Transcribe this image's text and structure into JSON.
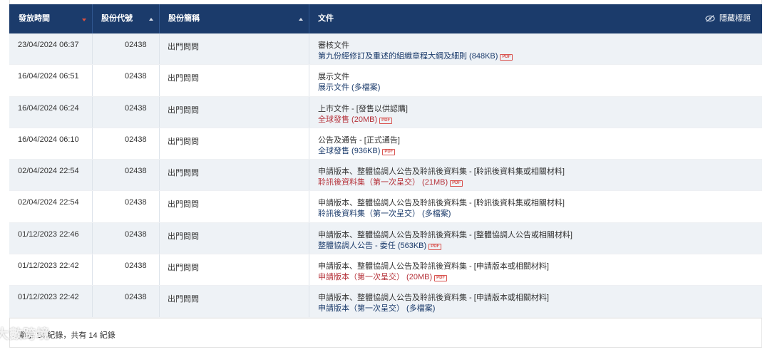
{
  "header": {
    "col_date": "發放時間",
    "col_code": "股份代號",
    "col_name": "股份簡稱",
    "col_doc": "文件",
    "hide_label": "隱藏標題"
  },
  "rows": [
    {
      "date": "23/04/2024 06:37",
      "code": "02438",
      "name": "出門問問",
      "doc_title": "審核文件",
      "doc_link": "第九份經修訂及重述的組織章程大綱及細則 (848KB)",
      "pdf": "PDF",
      "link_color": "normal"
    },
    {
      "date": "16/04/2024 06:51",
      "code": "02438",
      "name": "出門問問",
      "doc_title": "展示文件",
      "doc_link": "展示文件 (多檔案)",
      "pdf": "",
      "link_color": "normal"
    },
    {
      "date": "16/04/2024 06:24",
      "code": "02438",
      "name": "出門問問",
      "doc_title": "上市文件 - [發售以供認購]",
      "doc_link": "全球發售 (20MB)",
      "pdf": "PDF",
      "link_color": "red"
    },
    {
      "date": "16/04/2024 06:10",
      "code": "02438",
      "name": "出門問問",
      "doc_title": "公告及通告 - [正式通告]",
      "doc_link": "全球發售 (936KB)",
      "pdf": "PDF",
      "link_color": "normal"
    },
    {
      "date": "02/04/2024 22:54",
      "code": "02438",
      "name": "出門問問",
      "doc_title": "申請版本、整體協調人公告及聆訊後資料集 - [聆訊後資料集或相關材料]",
      "doc_link": "聆訊後資料集（第一次呈交） (21MB)",
      "pdf": "PDF",
      "link_color": "red"
    },
    {
      "date": "02/04/2024 22:54",
      "code": "02438",
      "name": "出門問問",
      "doc_title": "申請版本、整體協調人公告及聆訊後資料集 - [聆訊後資料集或相關材料]",
      "doc_link": "聆訊後資料集（第一次呈交） (多檔案)",
      "pdf": "",
      "link_color": "normal"
    },
    {
      "date": "01/12/2023 22:46",
      "code": "02438",
      "name": "出門問問",
      "doc_title": "申請版本、整體協調人公告及聆訊後資料集 - [整體協調人公告或相關材料]",
      "doc_link": "整體協調人公告 - 委任 (563KB)",
      "pdf": "PDF",
      "link_color": "normal"
    },
    {
      "date": "01/12/2023 22:42",
      "code": "02438",
      "name": "出門問問",
      "doc_title": "申請版本、整體協調人公告及聆訊後資料集 - [申請版本或相關材料]",
      "doc_link": "申請版本（第一次呈交） (20MB)",
      "pdf": "PDF",
      "link_color": "red"
    },
    {
      "date": "01/12/2023 22:42",
      "code": "02438",
      "name": "出門問問",
      "doc_title": "申請版本、整體協調人公告及聆訊後資料集 - [申請版本或相關材料]",
      "doc_link": "申請版本（第一次呈交） (多檔案)",
      "pdf": "",
      "link_color": "normal"
    }
  ],
  "footer": {
    "summary": "顯示 14 紀錄，共有 14 紀錄"
  },
  "watermark": "大數跨境",
  "colors": {
    "header_bg": "#1b3b6b",
    "row_alt_bg": "#eef2f6",
    "link": "#1b3b6b",
    "link_red": "#b5323a",
    "sort_active": "#e0513f"
  }
}
